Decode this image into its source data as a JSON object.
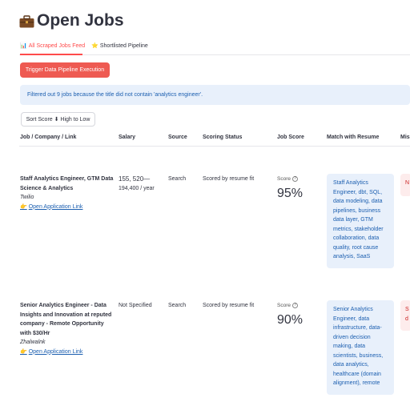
{
  "page": {
    "title": "Open Jobs",
    "title_icon": "briefcase-icon"
  },
  "tabs": [
    {
      "label": "All Scraped Jobs Feed",
      "icon": "chart-icon",
      "active": true
    },
    {
      "label": "Shortlisted Pipeline",
      "icon": "star-icon",
      "active": false
    }
  ],
  "actions": {
    "trigger_label": "Trigger Data Pipeline Execution",
    "sort_label": "Sort Score ⬇ High to Low"
  },
  "info": {
    "message": "Filtered out 9 jobs because the title did not contain 'analytics engineer'."
  },
  "table": {
    "headers": [
      "Job / Company / Link",
      "Salary",
      "Source",
      "Scoring Status",
      "Job Score",
      "Match with Resume",
      "Mis"
    ],
    "rows": [
      {
        "title_lines": [
          "Staff Analytics Engineer, GTM Data",
          "Science & Analytics"
        ],
        "company": "Twilio",
        "link": "Open Application Link",
        "salary_lines": [
          "155, 520—",
          "194,400 / year"
        ],
        "source": "Search",
        "status": "Scored by resume fit",
        "score_label": "Score",
        "score": "95%",
        "match_lines": [
          "Staff Analytics",
          "Engineer, dbt, SQL,",
          "data modeling, data",
          "pipelines, business",
          "data layer, GTM",
          "metrics, stakeholder",
          "collaboration, data",
          "quality, root cause",
          "analysis, SaaS"
        ],
        "missing": "N"
      },
      {
        "title_lines": [
          "Senior Analytics Engineer - Data",
          "Insights and Innovation at reputed",
          "company - Remote Opportunity",
          "with $30/Hr"
        ],
        "company": "Zhalwalnk",
        "link": "Open Application Link",
        "salary_lines": [
          "Not Specified"
        ],
        "source": "Search",
        "status": "Scored by resume fit",
        "score_label": "Score",
        "score": "90%",
        "match_lines": [
          "Senior Analytics",
          "Engineer, data",
          "infrastructure, data-",
          "driven decision",
          "making, data",
          "scientists, business,",
          "data analytics,",
          "healthcare (domain",
          "alignment), remote"
        ],
        "missing_lines": [
          "S",
          "d"
        ]
      }
    ]
  },
  "colors": {
    "accent": "#ff4b4b",
    "button": "#ee5a52",
    "info_bg": "#e8f0fb",
    "info_text": "#1c5fb0",
    "missing_bg": "#fdecec"
  }
}
